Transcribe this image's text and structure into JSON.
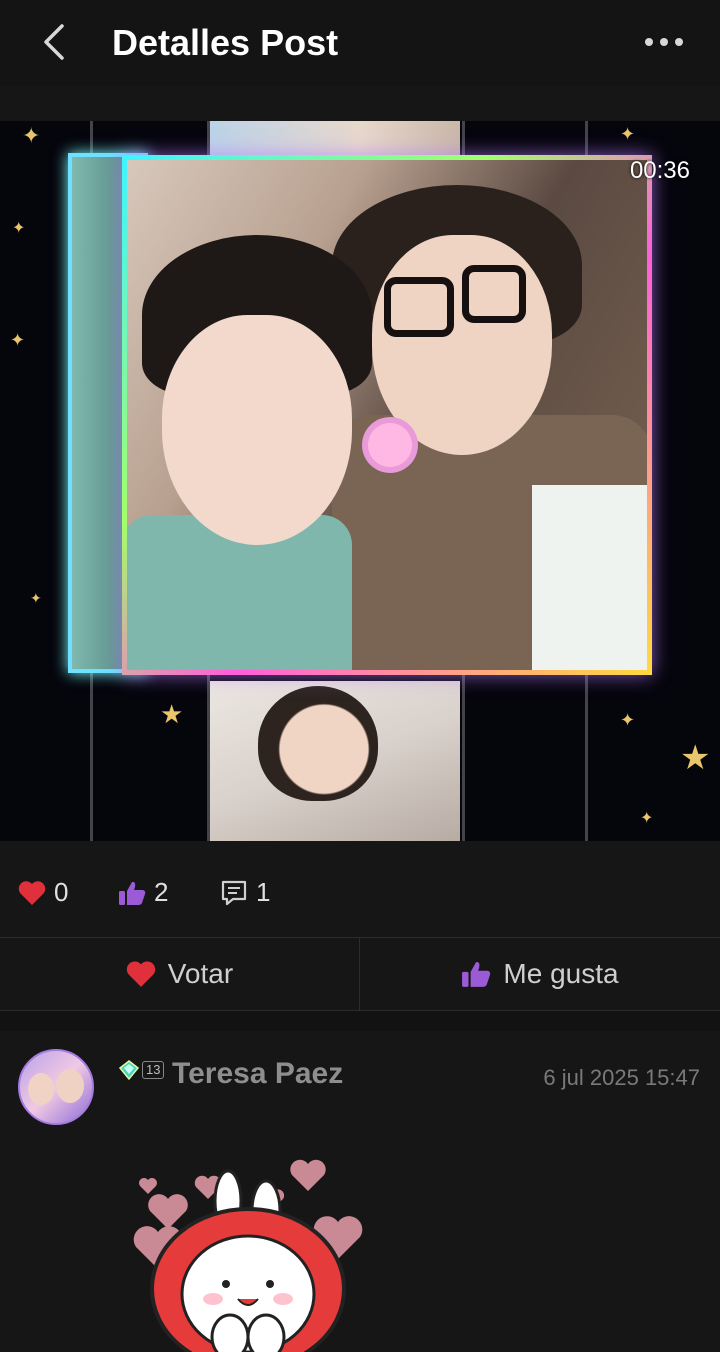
{
  "header": {
    "back_icon": "chevron-left-icon",
    "title": "Detalles Post",
    "more_icon": "more-horizontal-icon"
  },
  "media": {
    "type": "video",
    "timer": "00:36"
  },
  "stats": {
    "hearts": "0",
    "likes": "2",
    "comments": "1",
    "heart_color": "#e0303c",
    "like_color": "#9b5bd6"
  },
  "actions": {
    "vote_label": "Votar",
    "like_label": "Me gusta"
  },
  "comment": {
    "level": "13",
    "username": "Teresa Paez",
    "timestamp": "6 jul 2025 15:47",
    "sticker": "bunny-hearts-sticker"
  }
}
